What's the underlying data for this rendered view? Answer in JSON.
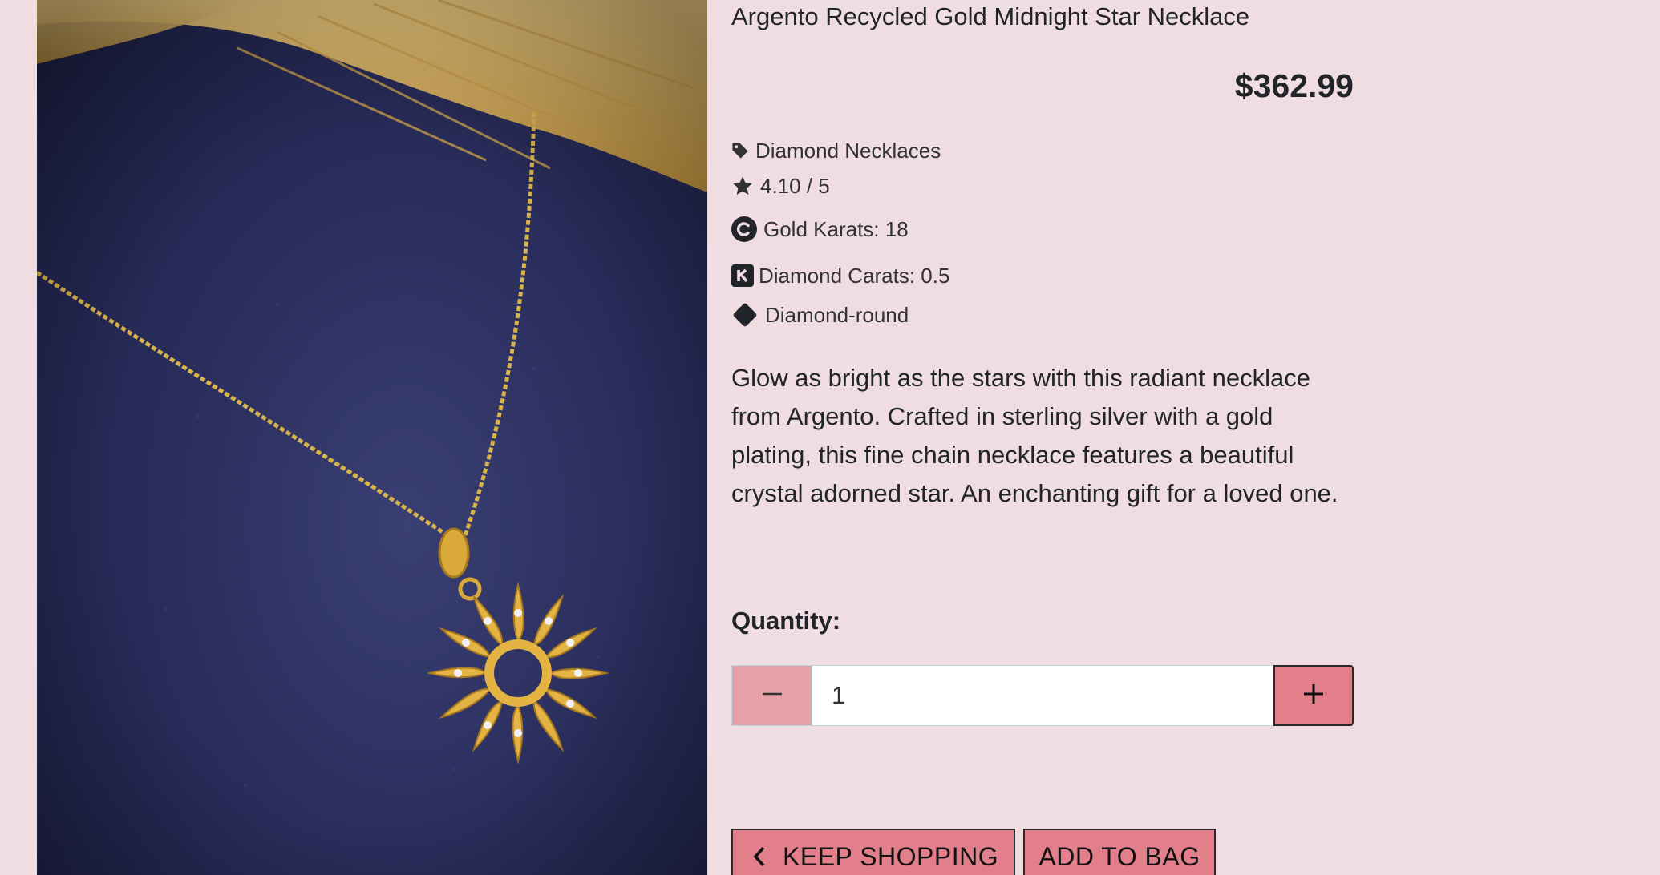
{
  "product": {
    "title": "Argento Recycled Gold Midnight Star Necklace",
    "price": "$362.99",
    "image_alt": "Argento Recycled Gold Midnight Star Necklace",
    "category": "Diamond Necklaces",
    "rating": "4.10 / 5",
    "gold_karats": "Gold Karats: 18",
    "diamond_carats": "Diamond Carats: 0.5",
    "diamond_shape": "Diamond-round",
    "description": "Glow as bright as the stars with this radiant necklace from Argento. Crafted in sterling silver with a gold plating, this fine chain necklace features a beautiful crystal adorned star. An enchanting gift for a loved one."
  },
  "quantity": {
    "label": "Quantity:",
    "value": "1",
    "minus_icon": "minus-icon",
    "plus_icon": "plus-icon"
  },
  "actions": {
    "keep_shopping": "KEEP SHOPPING",
    "add_to_bag": "ADD TO BAG"
  },
  "icons": {
    "category": "tag-icon",
    "rating": "star-icon",
    "gold": "copyright-circle-icon",
    "carats": "k-square-icon",
    "shape": "diamond-icon",
    "back": "chevron-left-icon"
  },
  "colors": {
    "page_background": "#f0dde1",
    "button": "#e27f8a",
    "minus_button": "#e6a0a7",
    "text": "#212529"
  }
}
